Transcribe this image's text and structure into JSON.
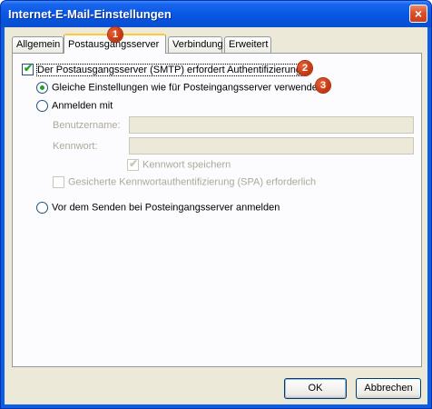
{
  "window": {
    "title": "Internet-E-Mail-Einstellungen",
    "close_glyph": "×"
  },
  "tabs": [
    {
      "label": "Allgemein"
    },
    {
      "label": "Postausgangsserver"
    },
    {
      "label": "Verbindung"
    },
    {
      "label": "Erweitert"
    }
  ],
  "badges": [
    "1",
    "2",
    "3"
  ],
  "outgoing": {
    "auth_required": {
      "label": "Der Postausgangsserver (SMTP) erfordert Authentifizierung",
      "checked": true
    },
    "same_settings": {
      "label": "Gleiche Einstellungen wie für Posteingangsserver verwenden",
      "selected": true
    },
    "login_with": {
      "label": "Anmelden mit",
      "selected": false
    },
    "username": {
      "label": "Benutzername:",
      "value": ""
    },
    "password": {
      "label": "Kennwort:",
      "value": ""
    },
    "save_password": {
      "label": "Kennwort speichern",
      "checked": true
    },
    "spa": {
      "label": "Gesicherte Kennwortauthentifizierung (SPA) erforderlich",
      "checked": false
    },
    "login_incoming_first": {
      "label": "Vor dem Senden bei Posteingangsserver anmelden",
      "selected": false
    }
  },
  "buttons": {
    "ok": "OK",
    "cancel": "Abbrechen"
  },
  "colors": {
    "titlebar": "#0a5ae6",
    "badge": "#c1330c",
    "check": "#21a121",
    "dialog": "#ece9d8"
  }
}
